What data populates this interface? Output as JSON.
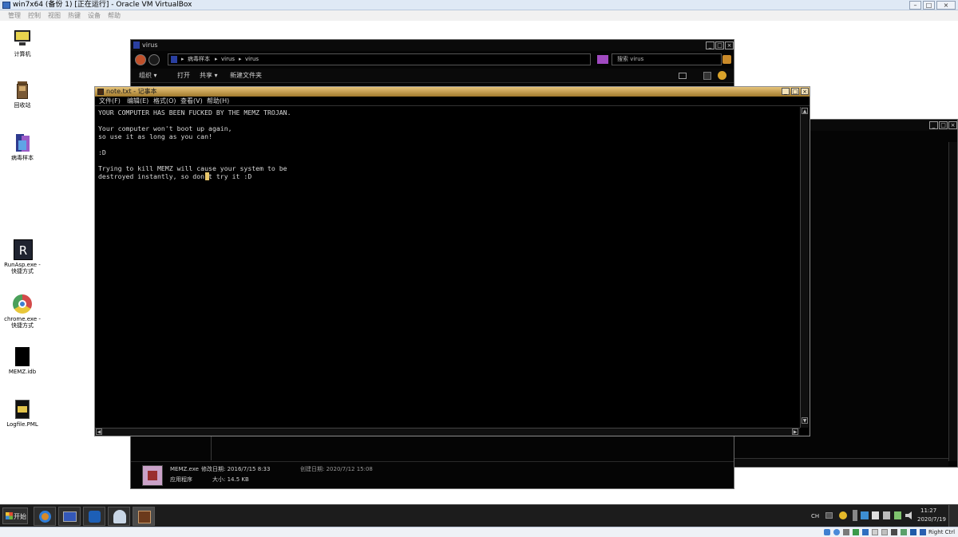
{
  "host": {
    "title": "win7x64 (备份 1) [正在运行] - Oracle VM VirtualBox",
    "menus": [
      "管理",
      "控制",
      "视图",
      "热键",
      "设备",
      "帮助"
    ],
    "status_host_key": "Right Ctrl"
  },
  "desktop": {
    "icons": [
      {
        "label": "计算机",
        "icon": "computer-icon"
      },
      {
        "label": "回收站",
        "icon": "recycle-bin-icon"
      },
      {
        "label": "病毒样本",
        "icon": "folder-icon"
      },
      {
        "label": "RunAsp.exe -\n快捷方式",
        "icon": "runasp-icon"
      },
      {
        "label": "chrome.exe -\n快捷方式",
        "icon": "chrome-icon"
      },
      {
        "label": "MEMZ.idb",
        "icon": "file-icon"
      },
      {
        "label": "Logfile.PML",
        "icon": "pml-icon"
      }
    ]
  },
  "explorer": {
    "title": "virus",
    "breadcrumb": [
      "病毒样本",
      "virus",
      "virus"
    ],
    "search_placeholder": "搜索 virus",
    "toolbar": [
      "组织 ▾",
      "打开",
      "共享 ▾",
      "新建文件夹"
    ],
    "details": {
      "name": "MEMZ.exe",
      "modified_label": "修改日期: 2016/7/15 8:33",
      "created_label": "创建日期: 2020/7/12 15:08",
      "type": "应用程序",
      "size": "大小: 14.5 KB"
    }
  },
  "notepad": {
    "title": "note.txt - 记事本",
    "menus": [
      "文件(F)",
      "编辑(E)",
      "格式(O)",
      "查看(V)",
      "帮助(H)"
    ],
    "text": "YOUR COMPUTER HAS BEEN FUCKED BY THE MEMZ TROJAN.\n\nYour computer won't boot up again,\nso use it as long as you can!\n\n:D\n\nTrying to kill MEMZ will cause your system to be\ndestroyed instantly, so don't try it :D"
  },
  "taskbar": {
    "start_label": "开始",
    "ime": "CH",
    "clock_time": "11:27",
    "clock_date": "2020/7/19"
  }
}
